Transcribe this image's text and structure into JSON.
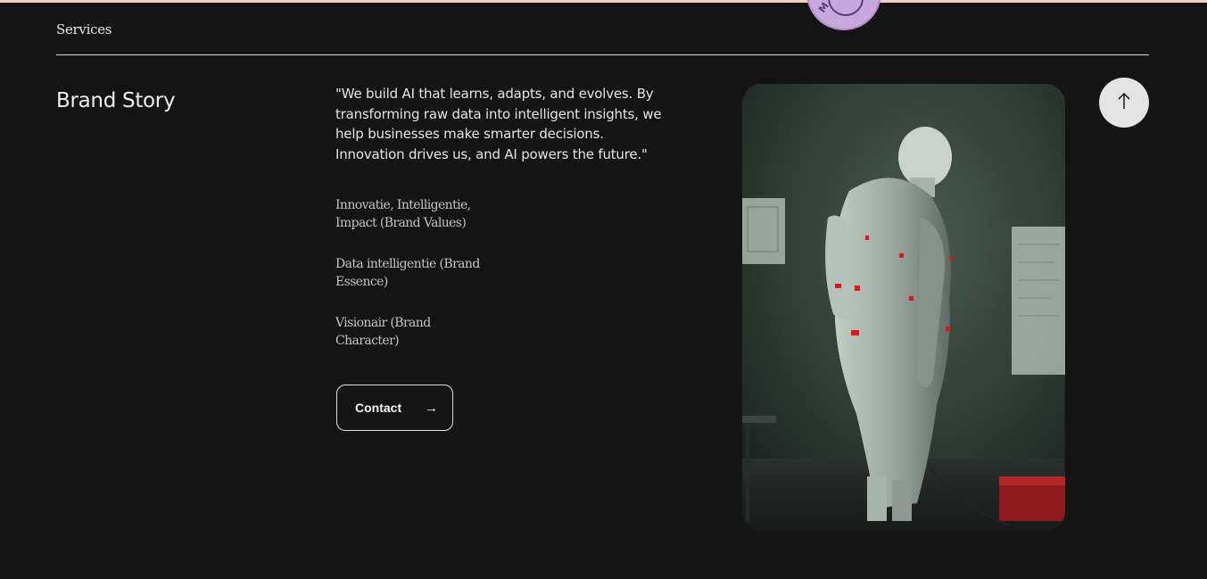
{
  "nav": {
    "services_label": "Services",
    "badge_letter": "M"
  },
  "brand_story": {
    "title": "Brand Story",
    "quote": "\"We build AI that learns, adapts, and evolves. By transforming raw data into intelligent insights, we help businesses make smarter decisions. Innovation drives us, and AI powers the future.\"",
    "values": [
      "Innovatie, Intelligentie, Impact (Brand Values)",
      "Data intelligentie (Brand Essence)",
      "Visionair (Brand Character)"
    ],
    "contact_label": "Contact",
    "contact_arrow": "→"
  },
  "hero_image": {
    "icon": "robot-figure-image"
  },
  "scroll_top": {
    "icon": "arrow-up-icon"
  },
  "colors": {
    "background": "#141414",
    "text": "#ececec",
    "muted_text": "#c4c4c4",
    "badge": "#c9a9dd",
    "top_strip": "#f1d2c0",
    "button_light": "#e4e4e4",
    "accent_red": "#e0161b"
  }
}
